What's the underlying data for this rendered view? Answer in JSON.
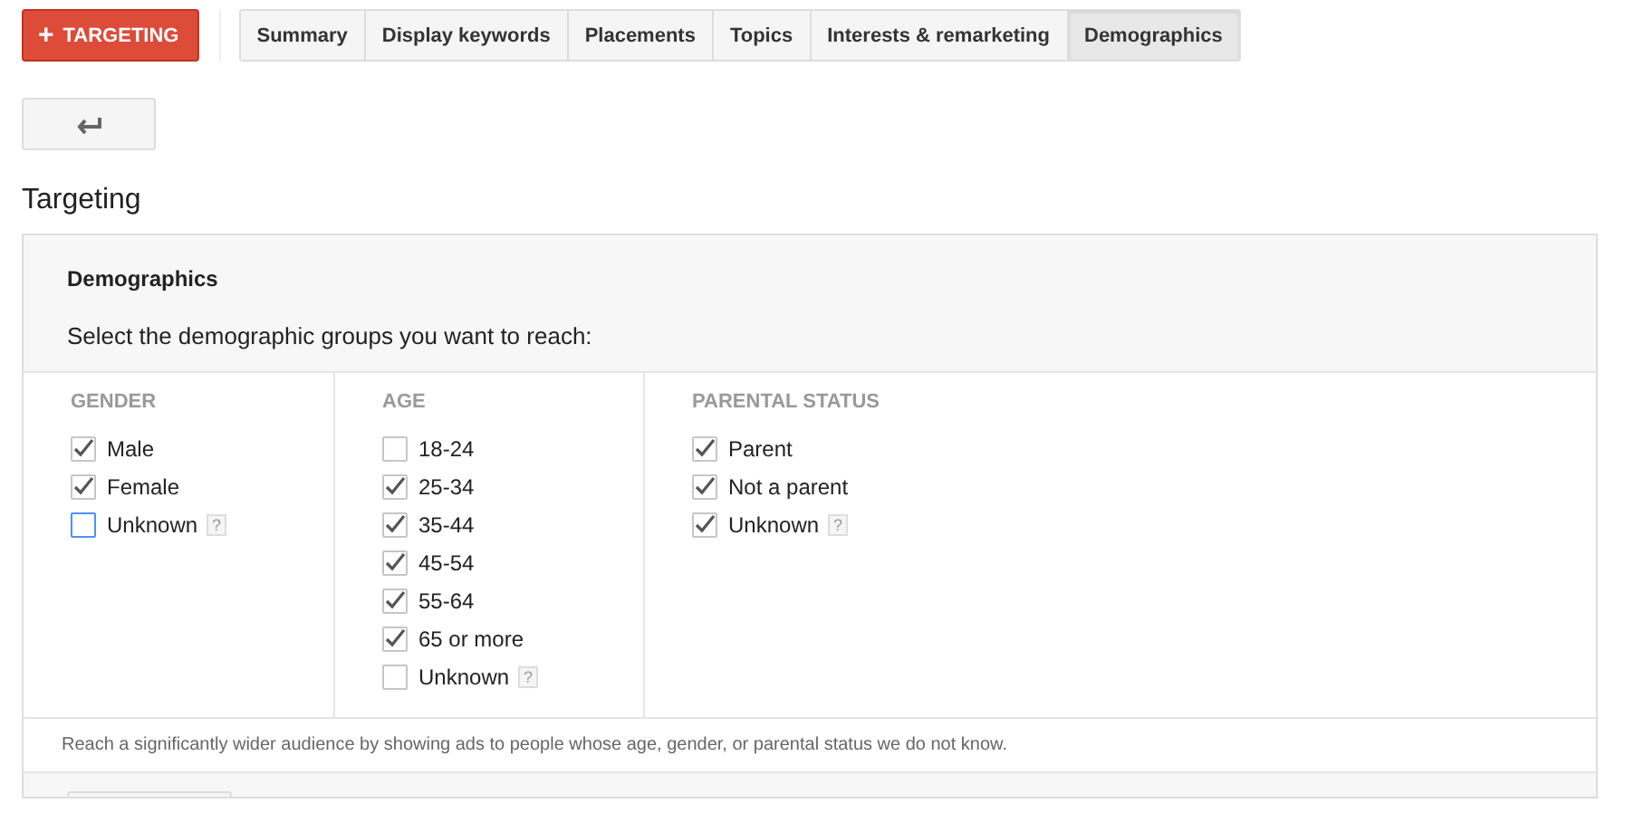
{
  "toolbar": {
    "add_button": {
      "icon": "+",
      "label": "TARGETING"
    },
    "tabs": [
      {
        "label": "Summary",
        "selected": false
      },
      {
        "label": "Display keywords",
        "selected": false
      },
      {
        "label": "Placements",
        "selected": false
      },
      {
        "label": "Topics",
        "selected": false
      },
      {
        "label": "Interests & remarketing",
        "selected": false
      },
      {
        "label": "Demographics",
        "selected": true
      }
    ]
  },
  "section_title": "Targeting",
  "panel": {
    "title": "Demographics",
    "prompt": "Select the demographic groups you want to reach:",
    "groups": [
      {
        "heading": "GENDER",
        "options": [
          {
            "label": "Male",
            "checked": true,
            "focused": false
          },
          {
            "label": "Female",
            "checked": true,
            "focused": false
          },
          {
            "label": "Unknown",
            "checked": false,
            "focused": true,
            "help": "?"
          }
        ]
      },
      {
        "heading": "AGE",
        "options": [
          {
            "label": "18-24",
            "checked": false,
            "focused": false
          },
          {
            "label": "25-34",
            "checked": true,
            "focused": false
          },
          {
            "label": "35-44",
            "checked": true,
            "focused": false
          },
          {
            "label": "45-54",
            "checked": true,
            "focused": false
          },
          {
            "label": "55-64",
            "checked": true,
            "focused": false
          },
          {
            "label": "65 or more",
            "checked": true,
            "focused": false
          },
          {
            "label": "Unknown",
            "checked": false,
            "focused": false,
            "help": "?"
          }
        ]
      },
      {
        "heading": "PARENTAL STATUS",
        "options": [
          {
            "label": "Parent",
            "checked": true,
            "focused": false
          },
          {
            "label": "Not a parent",
            "checked": true,
            "focused": false
          },
          {
            "label": "Unknown",
            "checked": true,
            "focused": false,
            "help": "?"
          }
        ]
      }
    ],
    "note": "Reach a significantly wider audience by showing ads to people whose age, gender, or parental status we do not know."
  }
}
